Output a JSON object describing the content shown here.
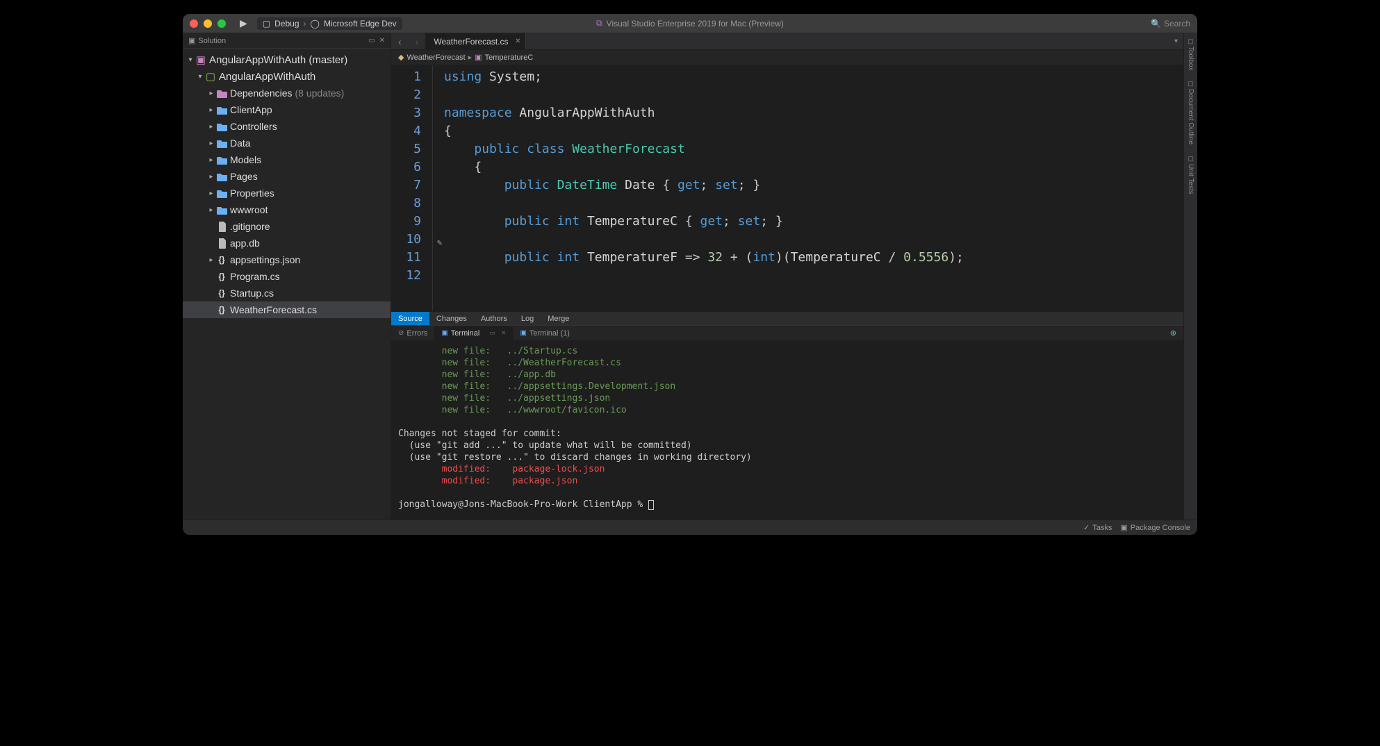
{
  "titlebar": {
    "config_target": "Debug",
    "config_browser": "Microsoft Edge Dev",
    "app_title": "Visual Studio Enterprise 2019 for Mac (Preview)",
    "search_placeholder": "Search"
  },
  "sidebar": {
    "header": "Solution",
    "items": [
      {
        "depth": 0,
        "chev": "▾",
        "icon": "solution",
        "label": "AngularAppWithAuth (master)",
        "sel": false
      },
      {
        "depth": 1,
        "chev": "▾",
        "icon": "csproj",
        "label": "AngularAppWithAuth",
        "sel": false
      },
      {
        "depth": 2,
        "chev": "▸",
        "icon": "folder-purple",
        "label": "Dependencies",
        "suffix": "(8 updates)",
        "sel": false
      },
      {
        "depth": 2,
        "chev": "▸",
        "icon": "folder",
        "label": "ClientApp",
        "sel": false
      },
      {
        "depth": 2,
        "chev": "▸",
        "icon": "folder",
        "label": "Controllers",
        "sel": false
      },
      {
        "depth": 2,
        "chev": "▸",
        "icon": "folder",
        "label": "Data",
        "sel": false
      },
      {
        "depth": 2,
        "chev": "▸",
        "icon": "folder",
        "label": "Models",
        "sel": false
      },
      {
        "depth": 2,
        "chev": "▸",
        "icon": "folder",
        "label": "Pages",
        "sel": false
      },
      {
        "depth": 2,
        "chev": "▸",
        "icon": "folder",
        "label": "Properties",
        "sel": false
      },
      {
        "depth": 2,
        "chev": "▸",
        "icon": "folder",
        "label": "wwwroot",
        "sel": false
      },
      {
        "depth": 2,
        "chev": "",
        "icon": "file",
        "label": ".gitignore",
        "sel": false
      },
      {
        "depth": 2,
        "chev": "",
        "icon": "file",
        "label": "app.db",
        "sel": false
      },
      {
        "depth": 2,
        "chev": "▸",
        "icon": "json",
        "label": "appsettings.json",
        "sel": false
      },
      {
        "depth": 2,
        "chev": "",
        "icon": "cs",
        "label": "Program.cs",
        "sel": false
      },
      {
        "depth": 2,
        "chev": "",
        "icon": "cs",
        "label": "Startup.cs",
        "sel": false
      },
      {
        "depth": 2,
        "chev": "",
        "icon": "cs",
        "label": "WeatherForecast.cs",
        "sel": true
      }
    ]
  },
  "editor": {
    "tab_label": "WeatherForecast.cs",
    "breadcrumb_class": "WeatherForecast",
    "breadcrumb_member": "TemperatureC",
    "lines": [
      {
        "n": 1,
        "tokens": [
          [
            "kw",
            "using"
          ],
          [
            "punct",
            " "
          ],
          [
            "ident",
            "System"
          ],
          [
            "punct",
            ";"
          ]
        ]
      },
      {
        "n": 2,
        "tokens": []
      },
      {
        "n": 3,
        "tokens": [
          [
            "kw",
            "namespace"
          ],
          [
            "punct",
            " "
          ],
          [
            "ident",
            "AngularAppWithAuth"
          ]
        ]
      },
      {
        "n": 4,
        "tokens": [
          [
            "punct",
            "{"
          ]
        ]
      },
      {
        "n": 5,
        "tokens": [
          [
            "punct",
            "    "
          ],
          [
            "kw",
            "public"
          ],
          [
            "punct",
            " "
          ],
          [
            "kw",
            "class"
          ],
          [
            "punct",
            " "
          ],
          [
            "cls",
            "WeatherForecast"
          ]
        ]
      },
      {
        "n": 6,
        "tokens": [
          [
            "punct",
            "    {"
          ]
        ]
      },
      {
        "n": 7,
        "tokens": [
          [
            "punct",
            "        "
          ],
          [
            "kw",
            "public"
          ],
          [
            "punct",
            " "
          ],
          [
            "cls",
            "DateTime"
          ],
          [
            "punct",
            " "
          ],
          [
            "ident",
            "Date"
          ],
          [
            "punct",
            " { "
          ],
          [
            "kw",
            "get"
          ],
          [
            "punct",
            "; "
          ],
          [
            "kw",
            "set"
          ],
          [
            "punct",
            "; }"
          ]
        ]
      },
      {
        "n": 8,
        "tokens": []
      },
      {
        "n": 9,
        "tokens": [
          [
            "punct",
            "        "
          ],
          [
            "kw",
            "public"
          ],
          [
            "punct",
            " "
          ],
          [
            "kw",
            "int"
          ],
          [
            "punct",
            " "
          ],
          [
            "ident",
            "TemperatureC"
          ],
          [
            "punct",
            " { "
          ],
          [
            "kw",
            "get"
          ],
          [
            "punct",
            "; "
          ],
          [
            "kw",
            "set"
          ],
          [
            "punct",
            "; }"
          ]
        ]
      },
      {
        "n": 10,
        "tokens": []
      },
      {
        "n": 11,
        "tokens": [
          [
            "punct",
            "        "
          ],
          [
            "kw",
            "public"
          ],
          [
            "punct",
            " "
          ],
          [
            "kw",
            "int"
          ],
          [
            "punct",
            " "
          ],
          [
            "ident",
            "TemperatureF"
          ],
          [
            "punct",
            " => "
          ],
          [
            "num",
            "32"
          ],
          [
            "punct",
            " + ("
          ],
          [
            "kw",
            "int"
          ],
          [
            "punct",
            ")("
          ],
          [
            "ident",
            "TemperatureC"
          ],
          [
            "punct",
            " / "
          ],
          [
            "num",
            "0.5556"
          ],
          [
            "punct",
            ");"
          ]
        ]
      },
      {
        "n": 12,
        "tokens": []
      }
    ]
  },
  "source_tabs": [
    "Source",
    "Changes",
    "Authors",
    "Log",
    "Merge"
  ],
  "term_tabs": {
    "errors": "Errors",
    "terminal": "Terminal",
    "terminal_1": "Terminal (1)"
  },
  "terminal": {
    "new_files": [
      {
        "label": "new file:",
        "path": "../Startup.cs"
      },
      {
        "label": "new file:",
        "path": "../WeatherForecast.cs"
      },
      {
        "label": "new file:",
        "path": "../app.db"
      },
      {
        "label": "new file:",
        "path": "../appsettings.Development.json"
      },
      {
        "label": "new file:",
        "path": "../appsettings.json"
      },
      {
        "label": "new file:",
        "path": "../wwwroot/favicon.ico"
      }
    ],
    "header_unstaged": "Changes not staged for commit:",
    "hint_add": "  (use \"git add <file>...\" to update what will be committed)",
    "hint_restore": "  (use \"git restore <file>...\" to discard changes in working directory)",
    "modified": [
      {
        "label": "modified:",
        "path": "package-lock.json"
      },
      {
        "label": "modified:",
        "path": "package.json"
      }
    ],
    "prompt": "jongalloway@Jons-MacBook-Pro-Work ClientApp % "
  },
  "statusbar": {
    "tasks": "Tasks",
    "package_console": "Package Console"
  },
  "right_rail": [
    "Toolbox",
    "Document Outline",
    "Unit Tests"
  ]
}
